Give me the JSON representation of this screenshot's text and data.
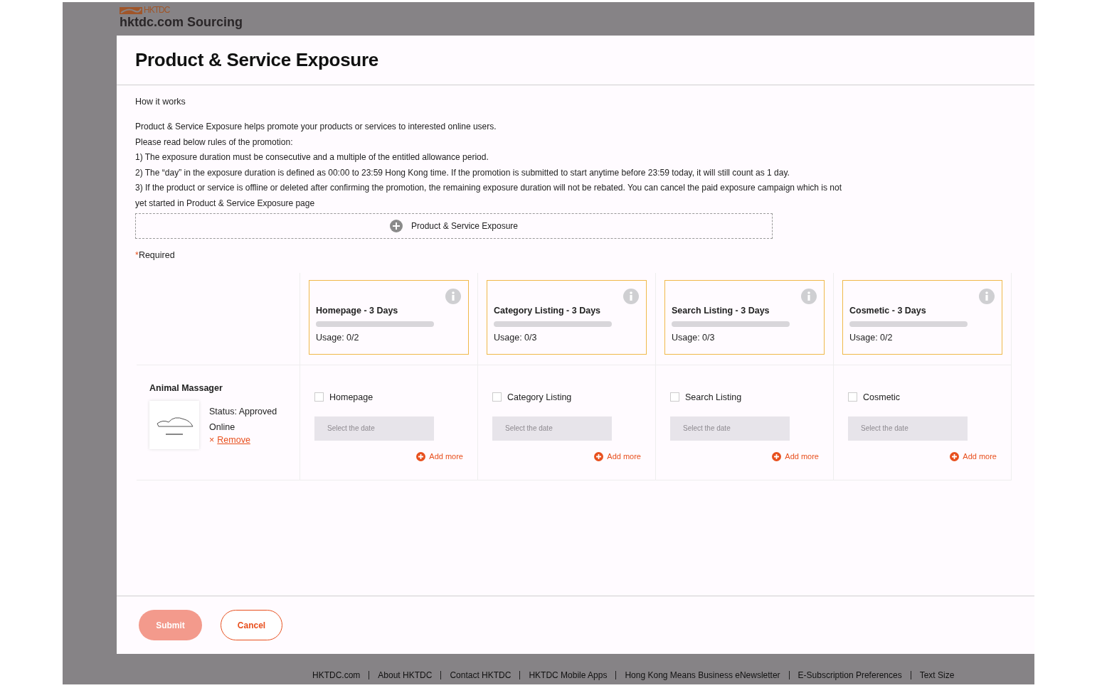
{
  "site_header": {
    "logo_text": "HKTDC",
    "site_name": "hktdc.com Sourcing"
  },
  "modal": {
    "title": "Product & Service Exposure",
    "intro_heading": "How it works",
    "paragraphs": [
      "Product & Service Exposure helps promote your products or services to interested online users.",
      "Please read below rules of the promotion:",
      "1) The exposure duration must be consecutive and a multiple of the entitled allowance period.",
      "2) The “day” in the exposure duration is defined as 00:00 to 23:59 Hong Kong time. If the promotion is submitted to start anytime before 23:59 today, it will still count as 1 day.",
      "3) If the product or service is offline or deleted after confirming the promotion, the remaining exposure duration will not be rebated. You can cancel the paid exposure campaign which is not yet started in Product & Service Exposure page"
    ],
    "add_exposure_button": "Product & Service Exposure",
    "required_mark": "*",
    "required_label": "Required",
    "allowances": [
      {
        "title": "Homepage - 3 Days",
        "level": 0,
        "usage": "Usage: 0/2"
      },
      {
        "title": "Category Listing - 3 Days",
        "level": 0,
        "usage": "Usage: 0/3"
      },
      {
        "title": "Search Listing - 3 Days",
        "level": 0,
        "usage": "Usage: 0/3"
      },
      {
        "title": "Cosmetic - 3 Days",
        "level": 0,
        "usage": "Usage: 0/2"
      }
    ],
    "product": {
      "name": "Animal Massager",
      "status": "Status: Approved",
      "state": "Online",
      "remove_icon": "×",
      "remove_link": "Remove",
      "options": [
        {
          "label": "Homepage",
          "checked": false,
          "date_placeholder": "Select the date",
          "add_more": "Add more"
        },
        {
          "label": "Category Listing",
          "checked": false,
          "date_placeholder": "Select the date",
          "add_more": "Add more"
        },
        {
          "label": "Search Listing",
          "checked": false,
          "date_placeholder": "Select the date",
          "add_more": "Add more"
        },
        {
          "label": "Cosmetic",
          "checked": false,
          "date_placeholder": "Select the date",
          "add_more": "Add more"
        }
      ]
    },
    "buttons": [
      {
        "label": "Submit",
        "kind": "primary",
        "disabled": true
      },
      {
        "label": "Cancel",
        "kind": "secondary",
        "disabled": false
      }
    ]
  },
  "footer_links": [
    "HKTDC.com",
    "About HKTDC",
    "Contact HKTDC",
    "HKTDC Mobile Apps",
    "Hong Kong Means Business eNewsletter",
    "E-Subscription Preferences",
    "Text Size"
  ]
}
